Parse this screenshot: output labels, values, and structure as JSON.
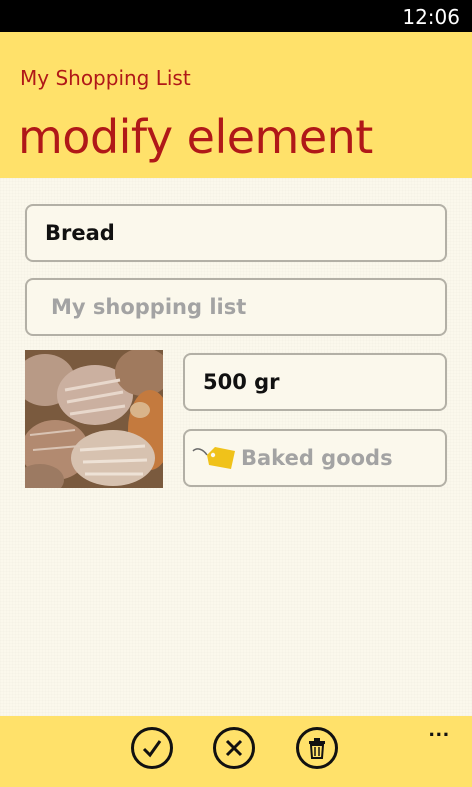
{
  "status_bar": {
    "time": "12:06"
  },
  "header": {
    "app_title": "My Shopping List",
    "page_title": "modify element"
  },
  "form": {
    "item_name": {
      "value": "Bread"
    },
    "list_name": {
      "value": "My shopping list"
    },
    "quantity": {
      "value": "500 gr"
    },
    "category": {
      "value": "Baked goods",
      "icon": "tag-icon"
    },
    "photo": {
      "icon": "bread-photo"
    }
  },
  "app_bar": {
    "buttons": [
      {
        "name": "save",
        "icon": "checkmark-icon"
      },
      {
        "name": "cancel",
        "icon": "close-icon"
      },
      {
        "name": "delete",
        "icon": "trash-icon"
      }
    ],
    "more": "..."
  },
  "colors": {
    "accent": "#ffe16a",
    "title_red": "#b01818",
    "background": "#fbf8ec",
    "border": "#b3b0a6",
    "placeholder": "#a3a3a3"
  }
}
